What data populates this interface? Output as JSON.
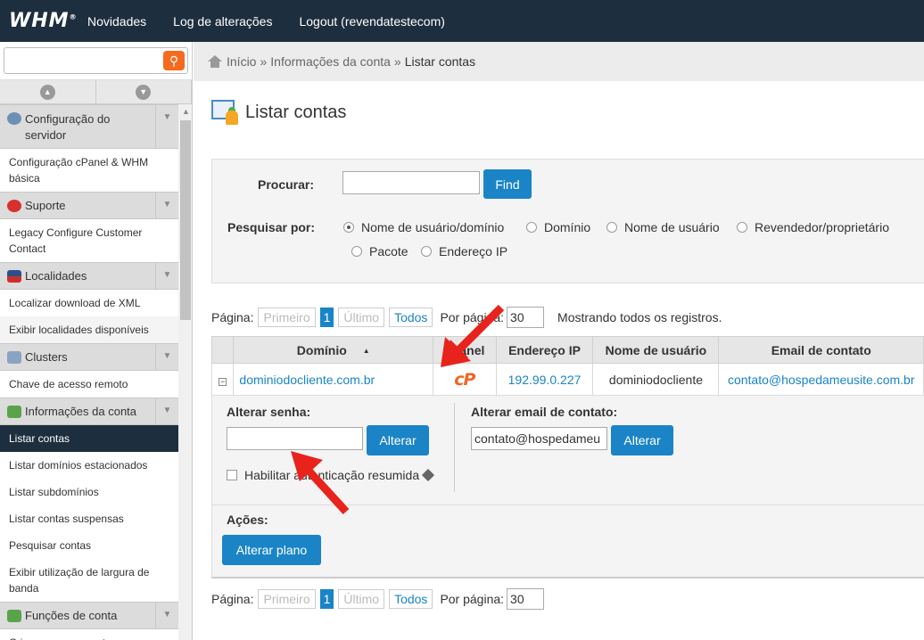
{
  "topbar": {
    "logo": "WHM",
    "nav": [
      "Novidades",
      "Log de alterações",
      "Logout (revendatestecom)"
    ]
  },
  "sidebar": {
    "search_placeholder": "",
    "sections": [
      {
        "title": "Configuração do servidor",
        "icon": "gear-icon",
        "items": [
          "Configuração cPanel & WHM básica"
        ]
      },
      {
        "title": "Suporte",
        "icon": "lifebuoy-icon",
        "items": [
          "Legacy Configure Customer Contact"
        ]
      },
      {
        "title": "Localidades",
        "icon": "flag-icon",
        "items": [
          "Localizar download de XML",
          "Exibir localidades disponíveis"
        ]
      },
      {
        "title": "Clusters",
        "icon": "cluster-icon",
        "items": [
          "Chave de acesso remoto"
        ]
      },
      {
        "title": "Informações da conta",
        "icon": "account-info-icon",
        "items": [
          "Listar contas",
          "Listar domínios estacionados",
          "Listar subdomínios",
          "Listar contas suspensas",
          "Pesquisar contas",
          "Exibir utilização de largura de banda"
        ]
      },
      {
        "title": "Funções de conta",
        "icon": "account-functions-icon",
        "items": [
          "Criar uma nova conta"
        ]
      }
    ],
    "active_item": "Listar contas"
  },
  "breadcrumb": {
    "items": [
      "Início",
      "Informações da conta",
      "Listar contas"
    ],
    "separator": "»"
  },
  "page": {
    "title": "Listar contas"
  },
  "search": {
    "label": "Procurar:",
    "value": "",
    "find_button": "Find",
    "search_by_label": "Pesquisar por:",
    "options": [
      "Nome de usuário/domínio",
      "Domínio",
      "Nome de usuário",
      "Revendedor/proprietário",
      "Pacote",
      "Endereço IP"
    ],
    "selected": "Nome de usuário/domínio"
  },
  "pager": {
    "label": "Página:",
    "first": "Primeiro",
    "current": "1",
    "last": "Último",
    "all": "Todos",
    "per_page_label": "Por página:",
    "per_page": "30",
    "showing": "Mostrando todos os registros."
  },
  "table": {
    "headers": [
      "Domínio",
      "cPanel",
      "Endereço IP",
      "Nome de usuário",
      "Email de contato"
    ],
    "rows": [
      {
        "domain": "dominiodocliente.com.br",
        "cpanel": "cP",
        "ip": "192.99.0.227",
        "username": "dominiodocliente",
        "email": "contato@hospedameusite.com.br"
      }
    ]
  },
  "detail": {
    "change_password_label": "Alterar senha:",
    "password_value": "",
    "change_password_button": "Alterar",
    "digest_auth_label": "Habilitar autenticação resumida",
    "change_email_label": "Alterar email de contato:",
    "email_value": "contato@hospedameu",
    "change_email_button": "Alterar",
    "actions_label": "Ações:",
    "change_plan_button": "Alterar plano"
  },
  "colors": {
    "topbar": "#1d2e3e",
    "accent": "#1a84c7",
    "cpanel": "#f26522",
    "annotation_arrow": "#e8231c"
  }
}
